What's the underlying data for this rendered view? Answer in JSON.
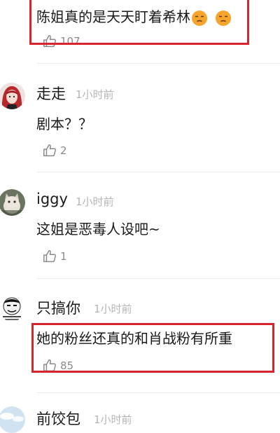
{
  "comments": [
    {
      "text": "陈姐真的是天天盯着希林",
      "emoji": [
        "unamused-face-emoji",
        "unamused-face-emoji"
      ],
      "likes": "107",
      "highlighted": true
    },
    {
      "username": "走走",
      "time": "1小时前",
      "text": "剧本？？",
      "likes": "2",
      "avatar": "red-haired-girl-avatar"
    },
    {
      "username": "iggy",
      "time": "1小时前",
      "text": "这姐是恶毒人设吧~",
      "likes": "1",
      "avatar": "cat-avatar"
    },
    {
      "username": "只搞你",
      "time": "1小时前",
      "text": "她的粉丝还真的和肖战粉有所重",
      "likes": "85",
      "avatar": "meme-face-avatar",
      "highlighted": true
    },
    {
      "username": "前饺包",
      "time": "1小时前",
      "avatar": "blue-sky-avatar"
    }
  ],
  "colors": {
    "highlight": "#d9232d",
    "timestamp": "#b5b5b5",
    "likeIcon": "#8a8a8a",
    "divider": "#ececec"
  }
}
